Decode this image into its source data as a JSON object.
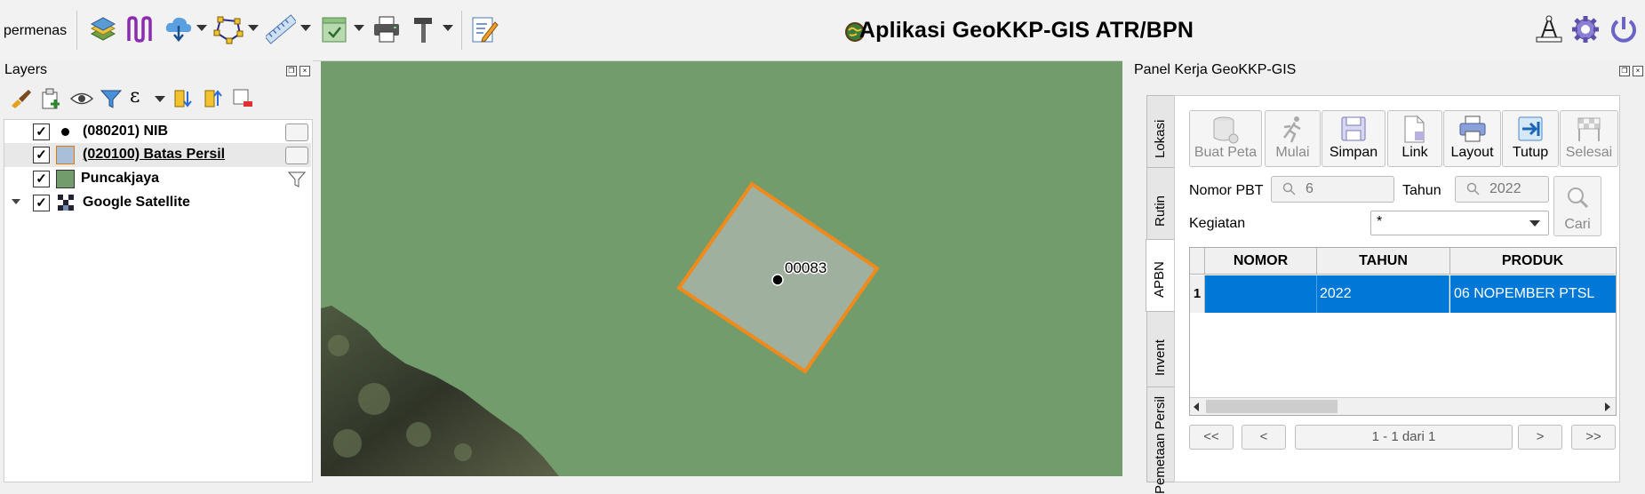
{
  "toolbar": {
    "user": "permenas",
    "title": "Aplikasi GeoKKP-GIS ATR/BPN",
    "icons": [
      "layers-icon",
      "path-icon",
      "cloud-download-icon",
      "polygon-icon",
      "measure-icon",
      "export-icon",
      "print-icon",
      "hammer-icon",
      "edit-notes-icon"
    ]
  },
  "layers": {
    "title": "Layers",
    "items": [
      {
        "name": "(080201) NIB",
        "checked": "✓"
      },
      {
        "name": "(020100) Batas Persil",
        "checked": "✓"
      },
      {
        "name": "Puncakjaya",
        "checked": "✓"
      },
      {
        "name": "Google Satellite",
        "checked": "✓"
      }
    ]
  },
  "map": {
    "parcel_label": "00083",
    "colors": {
      "background": "#729c6c",
      "parcel_fill": "#9fb09e",
      "parcel_stroke": "#f08a1a"
    }
  },
  "panel": {
    "title": "Panel Kerja GeoKKP-GIS",
    "tabs": [
      "Lokasi",
      "Rutin",
      "APBN",
      "Invent",
      "Pemetaan Persil"
    ],
    "active_tab": "APBN",
    "tools": [
      "Buat Peta",
      "Mulai",
      "Simpan",
      "Link",
      "Layout",
      "Tutup",
      "Selesai"
    ],
    "form": {
      "nomor_label": "Nomor PBT",
      "nomor_value": "6",
      "tahun_label": "Tahun",
      "tahun_value": "2022",
      "kegiatan_label": "Kegiatan",
      "kegiatan_value": "*",
      "cari_label": "Cari"
    },
    "table": {
      "columns": [
        "NOMOR",
        "TAHUN",
        "PRODUK"
      ],
      "rows": [
        {
          "index": "1",
          "nomor": "",
          "tahun": "2022",
          "produk": "06 NOPEMBER PTSL"
        }
      ]
    },
    "pager": {
      "first": "<<",
      "prev": "<",
      "info": "1 - 1 dari 1",
      "next": ">",
      "last": ">>"
    }
  }
}
